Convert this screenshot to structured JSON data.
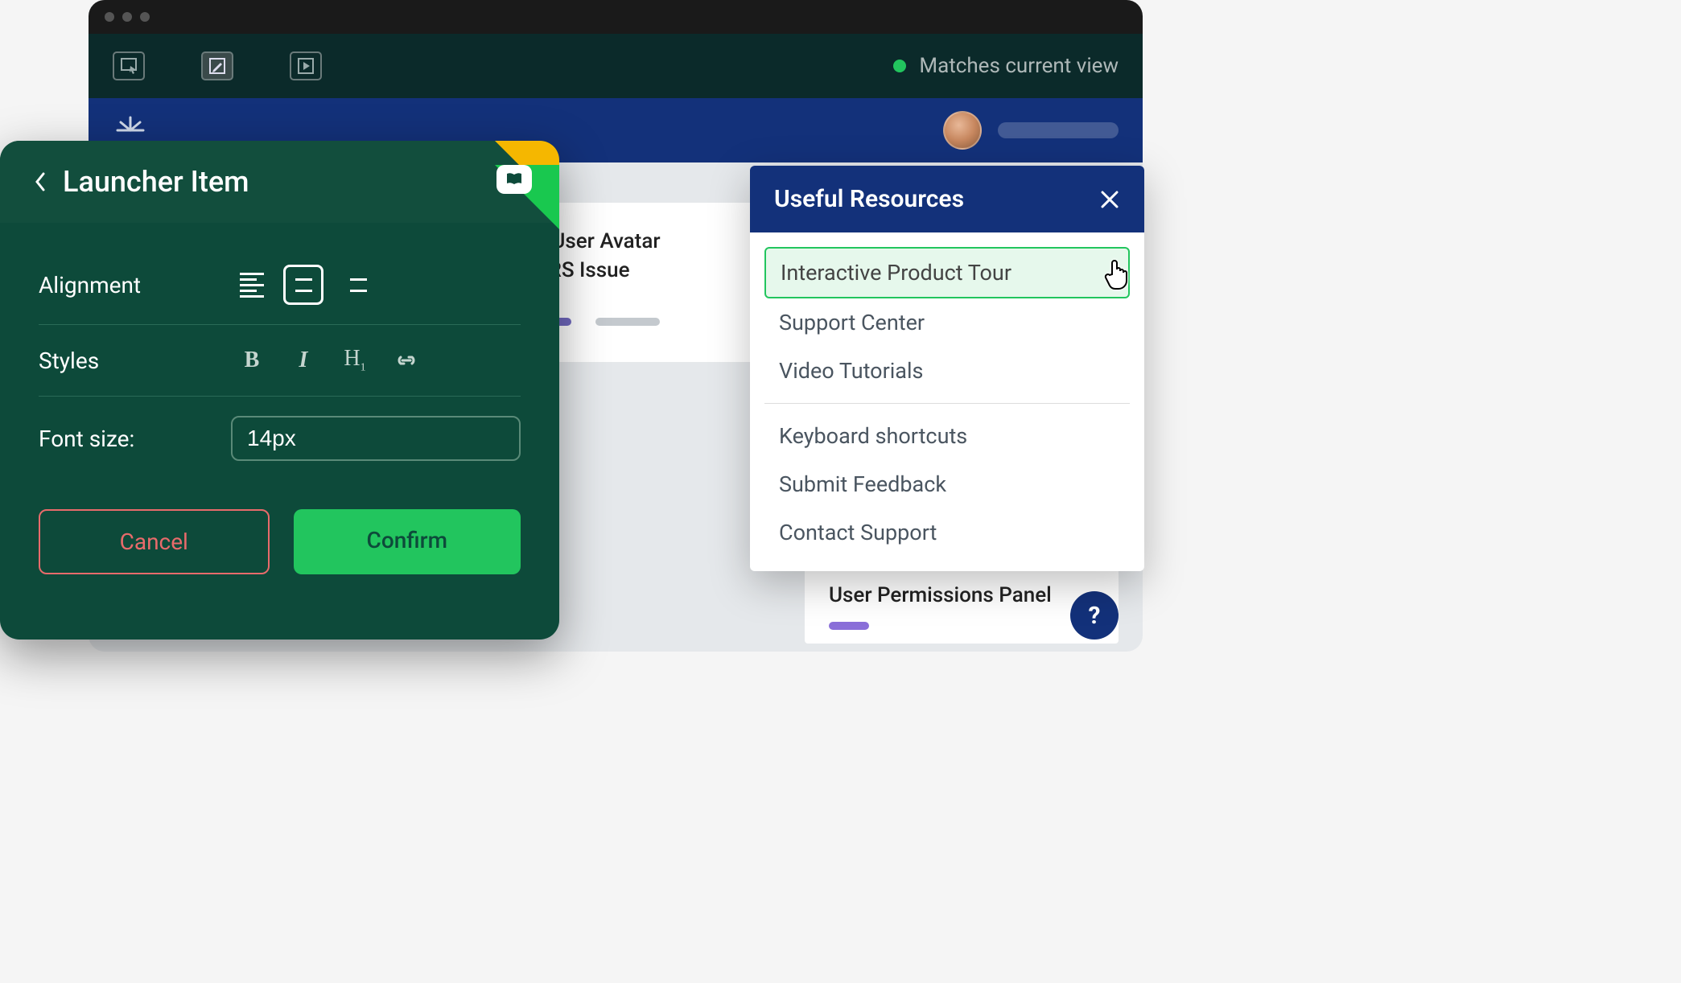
{
  "toolbar": {
    "status": "Matches current view"
  },
  "content": {
    "card_title_line1": "OST User Avatar",
    "card_title_line2": "/ CORS Issue",
    "right_card_title": "User Permissions Panel"
  },
  "launcher": {
    "title": "Launcher Item",
    "alignment_label": "Alignment",
    "styles_label": "Styles",
    "font_size_label": "Font size:",
    "font_size_value": "14px",
    "cancel": "Cancel",
    "confirm": "Confirm"
  },
  "resources": {
    "title": "Useful Resources",
    "items_top": [
      "Interactive Product Tour",
      "Support Center",
      "Video Tutorials"
    ],
    "items_bottom": [
      "Keyboard shortcuts",
      "Submit Feedback",
      "Contact Support"
    ]
  }
}
